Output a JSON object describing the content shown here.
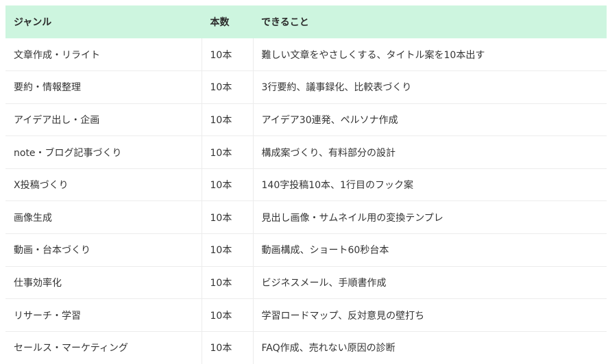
{
  "table": {
    "headers": {
      "genre": "ジャンル",
      "count": "本数",
      "capability": "できること"
    },
    "rows": [
      {
        "genre": "文章作成・リライト",
        "count": "10本",
        "capability": "難しい文章をやさしくする、タイトル案を10本出す"
      },
      {
        "genre": "要約・情報整理",
        "count": "10本",
        "capability": "3行要約、議事録化、比較表づくり"
      },
      {
        "genre": "アイデア出し・企画",
        "count": "10本",
        "capability": "アイデア30連発、ペルソナ作成"
      },
      {
        "genre": "note・ブログ記事づくり",
        "count": "10本",
        "capability": "構成案づくり、有料部分の設計"
      },
      {
        "genre": "X投稿づくり",
        "count": "10本",
        "capability": "140字投稿10本、1行目のフック案"
      },
      {
        "genre": "画像生成",
        "count": "10本",
        "capability": "見出し画像・サムネイル用の変換テンプレ"
      },
      {
        "genre": "動画・台本づくり",
        "count": "10本",
        "capability": "動画構成、ショート60秒台本"
      },
      {
        "genre": "仕事効率化",
        "count": "10本",
        "capability": "ビジネスメール、手順書作成"
      },
      {
        "genre": "リサーチ・学習",
        "count": "10本",
        "capability": "学習ロードマップ、反対意見の壁打ち"
      },
      {
        "genre": "セールス・マーケティング",
        "count": "10本",
        "capability": "FAQ作成、売れない原因の診断"
      }
    ]
  },
  "colors": {
    "header_bg": "#cdf5df",
    "row_border": "#ececec",
    "text": "#333333"
  }
}
